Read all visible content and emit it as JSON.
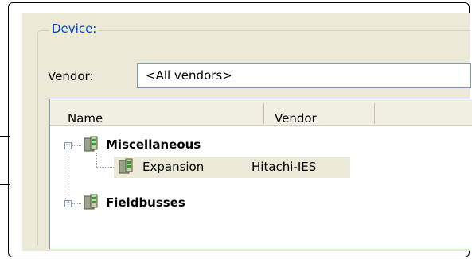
{
  "group": {
    "title": "Device:"
  },
  "vendor": {
    "label": "Vendor:",
    "value": "<All vendors>"
  },
  "list": {
    "columns": [
      "Name",
      "Vendor"
    ],
    "rows": [
      {
        "name": "Miscellaneous",
        "vendor": "",
        "expander": "−",
        "level": 0,
        "bold": true
      },
      {
        "name": "Expansion",
        "vendor": "Hitachi-IES",
        "expander": "",
        "level": 1,
        "bold": false,
        "selected": true
      },
      {
        "name": "Fieldbusses",
        "vendor": "",
        "expander": "+",
        "level": 0,
        "bold": true
      }
    ]
  },
  "icons": {
    "device": "device-module-icon"
  }
}
